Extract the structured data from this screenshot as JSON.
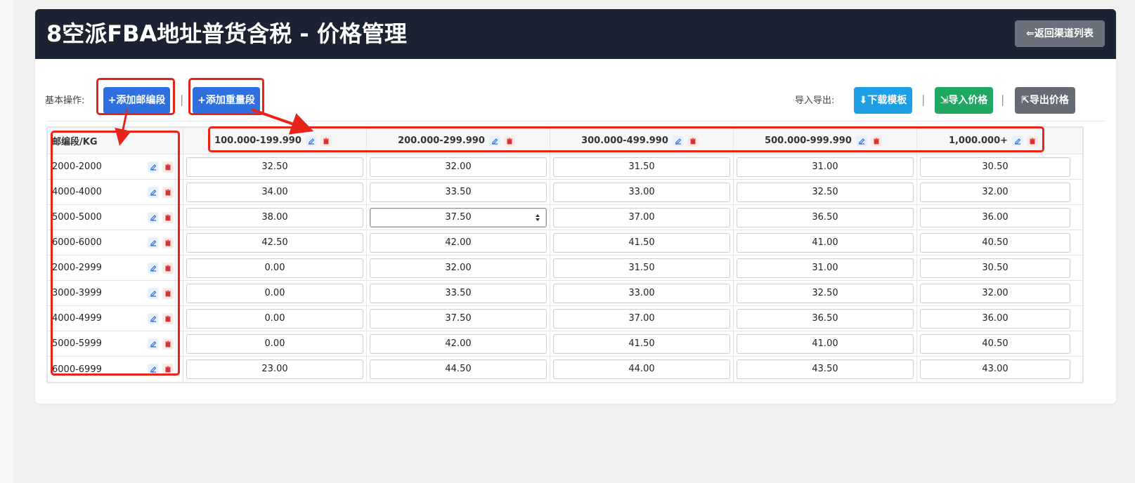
{
  "page": {
    "title": "8空派FBA地址普货含税 - 价格管理",
    "back_label": "返回渠道列表"
  },
  "toolbar": {
    "basic_label": "基本操作:",
    "add_zip_label": "添加邮编段",
    "add_weight_label": "添加重量段",
    "import_export_label": "导入导出:",
    "download_template_label": "下载模板",
    "import_label": "导入价格",
    "export_label": "导出价格",
    "separator": "|"
  },
  "table": {
    "corner_label": "邮编段/KG",
    "weight_ranges": [
      "100.000-199.990",
      "200.000-299.990",
      "300.000-499.990",
      "500.000-999.990",
      "1,000.000+"
    ],
    "rows": [
      {
        "zip": "2000-2000",
        "prices": [
          "32.50",
          "32.00",
          "31.50",
          "31.00",
          "30.50"
        ]
      },
      {
        "zip": "4000-4000",
        "prices": [
          "34.00",
          "33.50",
          "33.00",
          "32.50",
          "32.00"
        ]
      },
      {
        "zip": "5000-5000",
        "prices": [
          "38.00",
          "37.50",
          "37.00",
          "36.50",
          "36.00"
        ]
      },
      {
        "zip": "6000-6000",
        "prices": [
          "42.50",
          "42.00",
          "41.50",
          "41.00",
          "40.50"
        ]
      },
      {
        "zip": "2000-2999",
        "prices": [
          "0.00",
          "32.00",
          "31.50",
          "31.00",
          "30.50"
        ]
      },
      {
        "zip": "3000-3999",
        "prices": [
          "0.00",
          "33.50",
          "33.00",
          "32.50",
          "32.00"
        ]
      },
      {
        "zip": "4000-4999",
        "prices": [
          "0.00",
          "37.50",
          "37.00",
          "36.50",
          "36.00"
        ]
      },
      {
        "zip": "5000-5999",
        "prices": [
          "0.00",
          "42.00",
          "41.50",
          "41.00",
          "40.50"
        ]
      },
      {
        "zip": "6000-6999",
        "prices": [
          "23.00",
          "44.50",
          "44.00",
          "43.50",
          "43.00"
        ]
      }
    ]
  },
  "colors": {
    "header_bg": "#1b2231",
    "primary": "#2f6fde",
    "info": "#1e9ee4",
    "success": "#1fa862",
    "secondary": "#646b75",
    "danger": "#d9302f",
    "annotation": "#e8231a"
  }
}
